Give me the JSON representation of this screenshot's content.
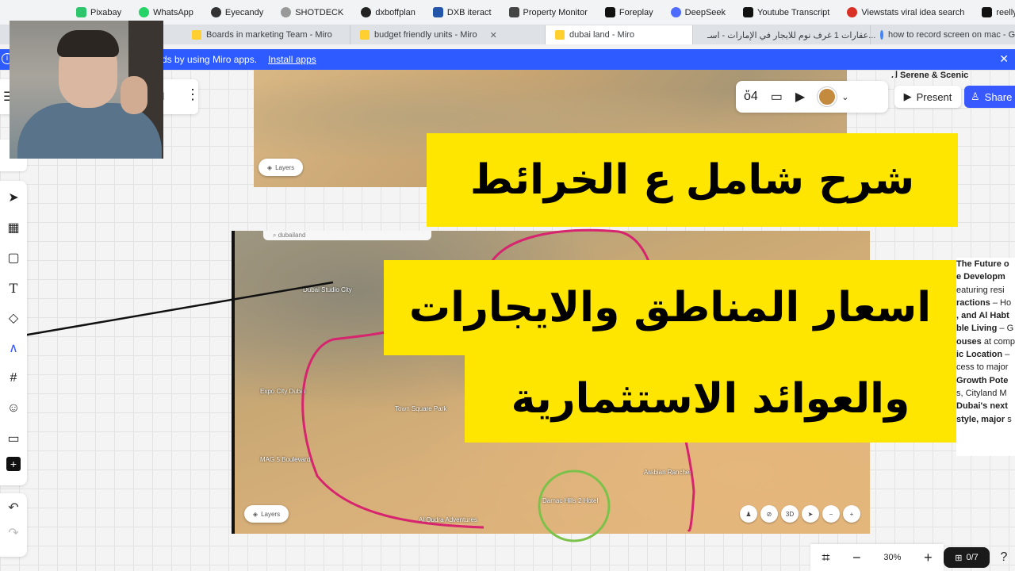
{
  "bookmarks": [
    {
      "label": "Pixabay",
      "color": "#2ec66d"
    },
    {
      "label": "WhatsApp",
      "color": "#25d366"
    },
    {
      "label": "Eyecandy",
      "color": "#333333"
    },
    {
      "label": "SHOTDECK",
      "color": "#777777"
    },
    {
      "label": "dxboffplan",
      "color": "#222222"
    },
    {
      "label": "DXB iteract",
      "color": "#2255aa"
    },
    {
      "label": "Property Monitor",
      "color": "#444444"
    },
    {
      "label": "Foreplay",
      "color": "#111111"
    },
    {
      "label": "DeepSeek",
      "color": "#4d6bfe"
    },
    {
      "label": "Youtube Transcript",
      "color": "#111111"
    },
    {
      "label": "Viewstats viral idea search",
      "color": "#d93025"
    },
    {
      "label": "reelly",
      "color": "#111111"
    }
  ],
  "tabs": [
    {
      "label": "Boards in marketing Team - Miro"
    },
    {
      "label": "budget friendly units - Miro"
    },
    {
      "label": "dubai land - Miro"
    },
    {
      "label": "عقارات 1 غرف نوم للايجار في الإمارات - اسـ..."
    },
    {
      "label": "how to record screen on mac - Go"
    }
  ],
  "banner": {
    "text": "ds by using Miro apps.",
    "install_label": "Install apps"
  },
  "board": {
    "name": "d"
  },
  "top_heading": "ل Serene & Scenic",
  "collab": {
    "present_label": "Present",
    "share_label": "Share"
  },
  "captions": {
    "line1": "شرح شامل ع الخرائط",
    "line2": "اسعار المناطق والايجارات",
    "line3": "والعوائد الاستثمارية"
  },
  "map": {
    "search_text": "dubailand",
    "layers_label": "Layers",
    "ctrl_3d": "3D",
    "places": [
      "Town Square Park",
      "Expo City Dubai",
      "MAG 5 Boulevard",
      "Damac Hills 2 Hotel",
      "Al Qudra Adventures",
      "Dubai Studio City",
      "Arabian Ranches"
    ]
  },
  "doc_lines": [
    {
      "bold": "The Future o",
      "rest": ""
    },
    {
      "bold": "e Developm",
      "rest": ""
    },
    {
      "bold": "",
      "rest": "eaturing resi"
    },
    {
      "bold": "ractions",
      "rest": " – Ho"
    },
    {
      "bold": ", and Al Habt",
      "rest": ""
    },
    {
      "bold": "ble Living",
      "rest": " – G"
    },
    {
      "bold": "ouses",
      "rest": " at comp"
    },
    {
      "bold": "ic Location",
      "rest": " –"
    },
    {
      "bold": "",
      "rest": "cess to major"
    },
    {
      "bold": "Growth Pote",
      "rest": ""
    },
    {
      "bold": "",
      "rest": "s, Cityland M"
    },
    {
      "bold": " Dubai's next",
      "rest": ""
    },
    {
      "bold": "style, major",
      "rest": " s"
    }
  ],
  "zoom": {
    "level": "30%",
    "minus": "−",
    "plus": "+"
  },
  "pager": {
    "count": "0/7"
  },
  "colors": {
    "caption_bg": "#ffe600",
    "banner_bg": "#2d5bff",
    "share_bg": "#3859ff",
    "boundary_line": "#d6246e",
    "highlight_circle": "#7cc24a"
  }
}
